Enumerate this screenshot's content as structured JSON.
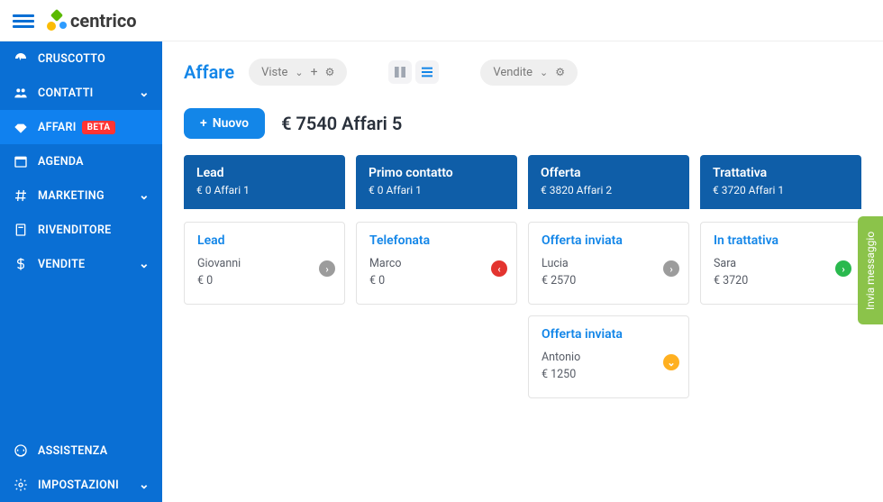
{
  "logo": "centrico",
  "sidebar": {
    "items": [
      {
        "label": "CRUSCOTTO",
        "icon": "dashboard-icon",
        "chevron": false
      },
      {
        "label": "CONTATTI",
        "icon": "contacts-icon",
        "chevron": true
      },
      {
        "label": "AFFARI",
        "icon": "deals-icon",
        "chevron": false,
        "badge": "BETA",
        "active": true
      },
      {
        "label": "AGENDA",
        "icon": "calendar-icon",
        "chevron": false
      },
      {
        "label": "MARKETING",
        "icon": "hash-icon",
        "chevron": true
      },
      {
        "label": "RIVENDITORE",
        "icon": "reseller-icon",
        "chevron": false
      },
      {
        "label": "VENDITE",
        "icon": "dollar-icon",
        "chevron": true
      }
    ],
    "bottom": [
      {
        "label": "ASSISTENZA",
        "icon": "support-icon",
        "chevron": false
      },
      {
        "label": "IMPOSTAZIONI",
        "icon": "gear-icon",
        "chevron": true
      }
    ]
  },
  "page": {
    "title": "Affare"
  },
  "toolbar": {
    "views_label": "Viste",
    "select_label": "Vendite",
    "new_label": "Nuovo"
  },
  "summary": {
    "amount": "€ 7540",
    "count_label": "Affari 5"
  },
  "columns": [
    {
      "name": "Lead",
      "sub": "€ 0 Affari 1",
      "cards": [
        {
          "title": "Lead",
          "person": "Giovanni",
          "amount": "€ 0",
          "status": "gray",
          "glyph": "›"
        }
      ]
    },
    {
      "name": "Primo contatto",
      "sub": "€ 0 Affari 1",
      "cards": [
        {
          "title": "Telefonata",
          "person": "Marco",
          "amount": "€ 0",
          "status": "red",
          "glyph": "‹"
        }
      ]
    },
    {
      "name": "Offerta",
      "sub": "€ 3820 Affari 2",
      "cards": [
        {
          "title": "Offerta inviata",
          "person": "Lucia",
          "amount": "€ 2570",
          "status": "gray",
          "glyph": "›"
        },
        {
          "title": "Offerta inviata",
          "person": "Antonio",
          "amount": "€ 1250",
          "status": "orange",
          "glyph": "⌄"
        }
      ]
    },
    {
      "name": "Trattativa",
      "sub": "€ 3720 Affari 1",
      "cards": [
        {
          "title": "In trattativa",
          "person": "Sara",
          "amount": "€ 3720",
          "status": "green",
          "glyph": "›"
        }
      ]
    }
  ],
  "floating": {
    "label": "Invia messaggio"
  }
}
